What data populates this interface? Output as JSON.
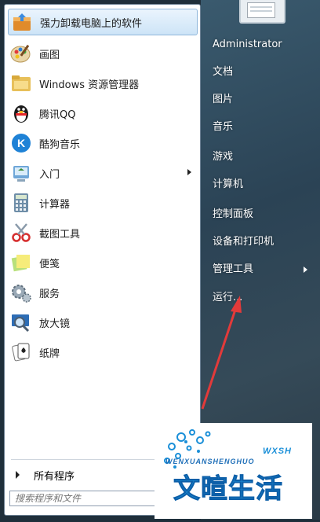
{
  "programs": [
    {
      "label": "强力卸载电脑上的软件",
      "icon": "uninstall-box-icon",
      "highlighted": true
    },
    {
      "label": "画图",
      "icon": "paint-palette-icon"
    },
    {
      "label": "Windows 资源管理器",
      "icon": "explorer-folder-icon"
    },
    {
      "label": "腾讯QQ",
      "icon": "qq-penguin-icon"
    },
    {
      "label": "酷狗音乐",
      "icon": "kugou-music-icon"
    },
    {
      "label": "入门",
      "icon": "getting-started-icon",
      "has_submenu": true
    },
    {
      "label": "计算器",
      "icon": "calculator-icon"
    },
    {
      "label": "截图工具",
      "icon": "snipping-tool-icon"
    },
    {
      "label": "便笺",
      "icon": "sticky-notes-icon"
    },
    {
      "label": "服务",
      "icon": "services-gear-icon"
    },
    {
      "label": "放大镜",
      "icon": "magnifier-icon"
    },
    {
      "label": "纸牌",
      "icon": "solitaire-cards-icon"
    }
  ],
  "all_programs_label": "所有程序",
  "search_placeholder": "搜索程序和文件",
  "places": [
    {
      "label": "Administrator"
    },
    {
      "label": "文档"
    },
    {
      "label": "图片"
    },
    {
      "label": "音乐"
    },
    {
      "label": "游戏"
    },
    {
      "label": "计算机"
    },
    {
      "label": "控制面板"
    },
    {
      "label": "设备和打印机"
    },
    {
      "label": "管理工具",
      "has_submenu": true
    },
    {
      "label": "运行..."
    }
  ],
  "watermark": {
    "pinyin": "WENXUANSHENGHUO",
    "brand": "文暄生活",
    "badge": "WXSH"
  },
  "colors": {
    "highlight": "#cde4f7",
    "annotation_arrow": "#e23a3a",
    "watermark_blue": "#1a8fd8"
  }
}
